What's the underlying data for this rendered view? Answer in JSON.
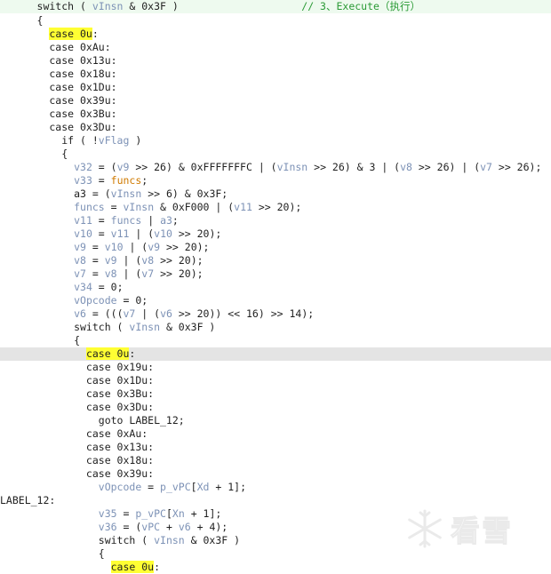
{
  "editor": {
    "lines": [
      [
        {
          "t": "      switch ( ",
          "c": "k"
        },
        {
          "t": "vInsn",
          "c": "vm"
        },
        {
          "t": " & 0x3F )                    ",
          "c": "k"
        },
        {
          "t": "// 3、Execute（执行）",
          "c": "c"
        }
      ],
      [
        {
          "t": "      {",
          "c": "k"
        }
      ],
      [
        {
          "t": "        ",
          "c": "k"
        },
        {
          "t": "case 0u",
          "c": "hl"
        },
        {
          "t": ":",
          "c": "k"
        }
      ],
      [
        {
          "t": "        case 0xAu:",
          "c": "k"
        }
      ],
      [
        {
          "t": "        case 0x13u:",
          "c": "k"
        }
      ],
      [
        {
          "t": "        case 0x18u:",
          "c": "k"
        }
      ],
      [
        {
          "t": "        case 0x1Du:",
          "c": "k"
        }
      ],
      [
        {
          "t": "        case 0x39u:",
          "c": "k"
        }
      ],
      [
        {
          "t": "        case 0x3Bu:",
          "c": "k"
        }
      ],
      [
        {
          "t": "        case 0x3Du:",
          "c": "k"
        }
      ],
      [
        {
          "t": "          if ( !",
          "c": "k"
        },
        {
          "t": "vFlag",
          "c": "vm"
        },
        {
          "t": " )",
          "c": "k"
        }
      ],
      [
        {
          "t": "          {",
          "c": "k"
        }
      ],
      [
        {
          "t": "            ",
          "c": "k"
        },
        {
          "t": "v32",
          "c": "vm"
        },
        {
          "t": " = (",
          "c": "k"
        },
        {
          "t": "v9",
          "c": "vm"
        },
        {
          "t": " >> 26) & 0xFFFFFFFC | (",
          "c": "k"
        },
        {
          "t": "vInsn",
          "c": "vm"
        },
        {
          "t": " >> 26) & 3 | (",
          "c": "k"
        },
        {
          "t": "v8",
          "c": "vm"
        },
        {
          "t": " >> 26) | (",
          "c": "k"
        },
        {
          "t": "v7",
          "c": "vm"
        },
        {
          "t": " >> 26);",
          "c": "k"
        }
      ],
      [
        {
          "t": "            ",
          "c": "k"
        },
        {
          "t": "v33",
          "c": "vm"
        },
        {
          "t": " = ",
          "c": "k"
        },
        {
          "t": "funcs",
          "c": "fn"
        },
        {
          "t": ";",
          "c": "k"
        }
      ],
      [
        {
          "t": "            ",
          "c": "k"
        },
        {
          "t": "a3",
          "c": "k"
        },
        {
          "t": " = (",
          "c": "k"
        },
        {
          "t": "vInsn",
          "c": "vm"
        },
        {
          "t": " >> 6) & 0x3F;",
          "c": "k"
        }
      ],
      [
        {
          "t": "            ",
          "c": "k"
        },
        {
          "t": "funcs",
          "c": "vm"
        },
        {
          "t": " = ",
          "c": "k"
        },
        {
          "t": "vInsn",
          "c": "vm"
        },
        {
          "t": " & 0xF000 | (",
          "c": "k"
        },
        {
          "t": "v11",
          "c": "vm"
        },
        {
          "t": " >> 20);",
          "c": "k"
        }
      ],
      [
        {
          "t": "            ",
          "c": "k"
        },
        {
          "t": "v11",
          "c": "vm"
        },
        {
          "t": " = ",
          "c": "k"
        },
        {
          "t": "funcs",
          "c": "vm"
        },
        {
          "t": " | ",
          "c": "k"
        },
        {
          "t": "a3",
          "c": "vm"
        },
        {
          "t": ";",
          "c": "k"
        }
      ],
      [
        {
          "t": "            ",
          "c": "k"
        },
        {
          "t": "v10",
          "c": "vm"
        },
        {
          "t": " = ",
          "c": "k"
        },
        {
          "t": "v11",
          "c": "vm"
        },
        {
          "t": " | (",
          "c": "k"
        },
        {
          "t": "v10",
          "c": "vm"
        },
        {
          "t": " >> 20);",
          "c": "k"
        }
      ],
      [
        {
          "t": "            ",
          "c": "k"
        },
        {
          "t": "v9",
          "c": "vm"
        },
        {
          "t": " = ",
          "c": "k"
        },
        {
          "t": "v10",
          "c": "vm"
        },
        {
          "t": " | (",
          "c": "k"
        },
        {
          "t": "v9",
          "c": "vm"
        },
        {
          "t": " >> 20);",
          "c": "k"
        }
      ],
      [
        {
          "t": "            ",
          "c": "k"
        },
        {
          "t": "v8",
          "c": "vm"
        },
        {
          "t": " = ",
          "c": "k"
        },
        {
          "t": "v9",
          "c": "vm"
        },
        {
          "t": " | (",
          "c": "k"
        },
        {
          "t": "v8",
          "c": "vm"
        },
        {
          "t": " >> 20);",
          "c": "k"
        }
      ],
      [
        {
          "t": "            ",
          "c": "k"
        },
        {
          "t": "v7",
          "c": "vm"
        },
        {
          "t": " = ",
          "c": "k"
        },
        {
          "t": "v8",
          "c": "vm"
        },
        {
          "t": " | (",
          "c": "k"
        },
        {
          "t": "v7",
          "c": "vm"
        },
        {
          "t": " >> 20);",
          "c": "k"
        }
      ],
      [
        {
          "t": "            ",
          "c": "k"
        },
        {
          "t": "v34",
          "c": "vm"
        },
        {
          "t": " = 0;",
          "c": "k"
        }
      ],
      [
        {
          "t": "            ",
          "c": "k"
        },
        {
          "t": "vOpcode",
          "c": "vm"
        },
        {
          "t": " = 0;",
          "c": "k"
        }
      ],
      [
        {
          "t": "            ",
          "c": "k"
        },
        {
          "t": "v6",
          "c": "vm"
        },
        {
          "t": " = (((",
          "c": "k"
        },
        {
          "t": "v7",
          "c": "vm"
        },
        {
          "t": " | (",
          "c": "k"
        },
        {
          "t": "v6",
          "c": "vm"
        },
        {
          "t": " >> 20)) << 16) >> 14);",
          "c": "k"
        }
      ],
      [
        {
          "t": "            switch ( ",
          "c": "k"
        },
        {
          "t": "vInsn",
          "c": "vm"
        },
        {
          "t": " & 0x3F )",
          "c": "k"
        }
      ],
      [
        {
          "t": "            {",
          "c": "k"
        }
      ],
      [
        {
          "t": "              ",
          "c": "k"
        },
        {
          "t": "case 0u",
          "c": "hl"
        },
        {
          "t": ":",
          "c": "k"
        }
      ],
      [
        {
          "t": "              case 0x19u:",
          "c": "k"
        }
      ],
      [
        {
          "t": "              case 0x1Du:",
          "c": "k"
        }
      ],
      [
        {
          "t": "              case 0x3Bu:",
          "c": "k"
        }
      ],
      [
        {
          "t": "              case 0x3Du:",
          "c": "k"
        }
      ],
      [
        {
          "t": "                goto LABEL_12;",
          "c": "k"
        }
      ],
      [
        {
          "t": "              case 0xAu:",
          "c": "k"
        }
      ],
      [
        {
          "t": "              case 0x13u:",
          "c": "k"
        }
      ],
      [
        {
          "t": "              case 0x18u:",
          "c": "k"
        }
      ],
      [
        {
          "t": "              case 0x39u:",
          "c": "k"
        }
      ],
      [
        {
          "t": "                ",
          "c": "k"
        },
        {
          "t": "vOpcode",
          "c": "vm"
        },
        {
          "t": " = ",
          "c": "k"
        },
        {
          "t": "p_vPC",
          "c": "vm"
        },
        {
          "t": "[",
          "c": "k"
        },
        {
          "t": "Xd",
          "c": "vm"
        },
        {
          "t": " + 1];",
          "c": "k"
        }
      ],
      [
        {
          "t": "LABEL_12:",
          "c": "lbl"
        }
      ],
      [
        {
          "t": "                ",
          "c": "k"
        },
        {
          "t": "v35",
          "c": "vm"
        },
        {
          "t": " = ",
          "c": "k"
        },
        {
          "t": "p_vPC",
          "c": "vm"
        },
        {
          "t": "[",
          "c": "k"
        },
        {
          "t": "Xn",
          "c": "vm"
        },
        {
          "t": " + 1];",
          "c": "k"
        }
      ],
      [
        {
          "t": "                ",
          "c": "k"
        },
        {
          "t": "v36",
          "c": "vm"
        },
        {
          "t": " = (",
          "c": "k"
        },
        {
          "t": "vPC",
          "c": "vm"
        },
        {
          "t": " + ",
          "c": "k"
        },
        {
          "t": "v6",
          "c": "vm"
        },
        {
          "t": " + 4);",
          "c": "k"
        }
      ],
      [
        {
          "t": "                switch ( ",
          "c": "k"
        },
        {
          "t": "vInsn",
          "c": "vm"
        },
        {
          "t": " & 0x3F )",
          "c": "k"
        }
      ],
      [
        {
          "t": "                {",
          "c": "k"
        }
      ],
      [
        {
          "t": "                  ",
          "c": "k"
        },
        {
          "t": "case 0u",
          "c": "hl"
        },
        {
          "t": ":",
          "c": "k"
        }
      ]
    ],
    "line_tops": [
      0,
      16,
      31,
      46,
      61,
      76,
      91,
      106,
      121,
      136,
      151,
      166,
      181,
      196,
      211,
      226,
      241,
      256,
      271,
      286,
      301,
      316,
      331,
      346,
      361,
      376,
      391,
      406,
      421,
      436,
      451,
      466,
      481,
      496,
      511,
      526,
      541,
      556,
      571,
      586,
      601,
      616,
      631
    ],
    "highlighted_line_index": 26,
    "first_line_tint": true
  },
  "watermark": {
    "text": "看雪",
    "icon": "snowflake-icon"
  }
}
